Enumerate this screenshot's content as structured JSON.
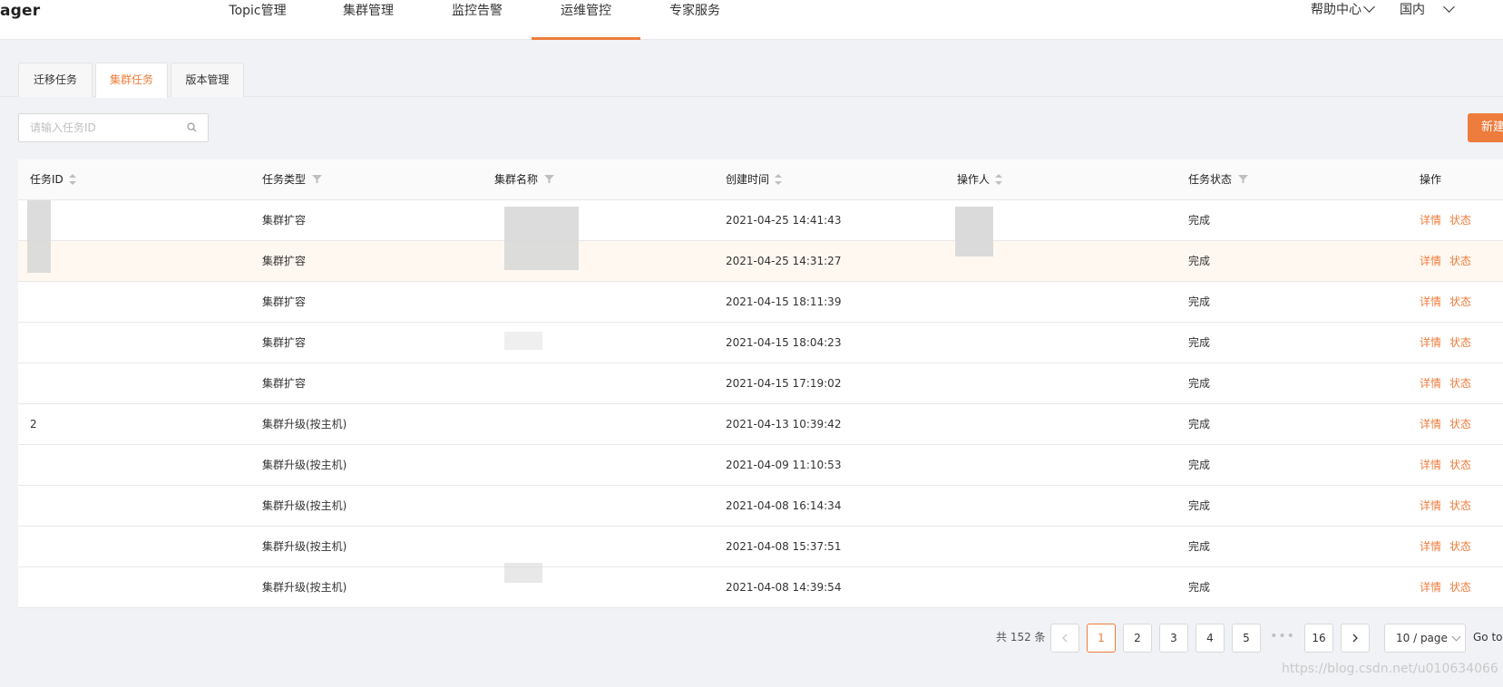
{
  "header": {
    "logo": "ager",
    "nav": [
      {
        "label": "Topic管理"
      },
      {
        "label": "集群管理"
      },
      {
        "label": "监控告警"
      },
      {
        "label": "运维管控"
      },
      {
        "label": "专家服务"
      }
    ],
    "active_nav": "运维管控",
    "help": "帮助中心",
    "region": "国内"
  },
  "subtabs": [
    {
      "label": "迁移任务"
    },
    {
      "label": "集群任务"
    },
    {
      "label": "版本管理"
    }
  ],
  "active_subtab": "集群任务",
  "search": {
    "placeholder": "请输入任务ID"
  },
  "new_button": "新建",
  "table": {
    "columns": [
      "任务ID",
      "任务类型",
      "集群名称",
      "创建时间",
      "操作人",
      "任务状态",
      "操作"
    ],
    "rows": [
      {
        "id": "",
        "type": "集群扩容",
        "cluster": "",
        "created": "2021-04-25 14:41:43",
        "operator": "",
        "status": "完成"
      },
      {
        "id": "",
        "type": "集群扩容",
        "cluster": "",
        "created": "2021-04-25 14:31:27",
        "operator": "",
        "status": "完成"
      },
      {
        "id": "",
        "type": "集群扩容",
        "cluster": "",
        "created": "2021-04-15 18:11:39",
        "operator": "",
        "status": "完成"
      },
      {
        "id": "",
        "type": "集群扩容",
        "cluster": "",
        "created": "2021-04-15 18:04:23",
        "operator": "",
        "status": "完成"
      },
      {
        "id": "",
        "type": "集群扩容",
        "cluster": "",
        "created": "2021-04-15 17:19:02",
        "operator": "",
        "status": "完成"
      },
      {
        "id": "2",
        "type": "集群升级(按主机)",
        "cluster": "",
        "created": "2021-04-13 10:39:42",
        "operator": "",
        "status": "完成"
      },
      {
        "id": "",
        "type": "集群升级(按主机)",
        "cluster": "",
        "created": "2021-04-09 11:10:53",
        "operator": "",
        "status": "完成"
      },
      {
        "id": "",
        "type": "集群升级(按主机)",
        "cluster": "",
        "created": "2021-04-08 16:14:34",
        "operator": "",
        "status": "完成"
      },
      {
        "id": "",
        "type": "集群升级(按主机)",
        "cluster": "",
        "created": "2021-04-08 15:37:51",
        "operator": "",
        "status": "完成"
      },
      {
        "id": "",
        "type": "集群升级(按主机)",
        "cluster": "",
        "created": "2021-04-08 14:39:54",
        "operator": "",
        "status": "完成"
      }
    ],
    "actions": {
      "detail": "详情",
      "state": "状态"
    }
  },
  "pagination": {
    "total_text": "共 152 条",
    "pages": [
      "1",
      "2",
      "3",
      "4",
      "5"
    ],
    "last_page": "16",
    "current": "1",
    "ellipsis": "•••",
    "page_size": "10 / page",
    "goto": "Go to"
  },
  "watermark": "https://blog.csdn.net/u010634066",
  "colors": {
    "accent": "#ee7c3c",
    "background": "#f0f2f5",
    "border": "#e8e8e8"
  }
}
